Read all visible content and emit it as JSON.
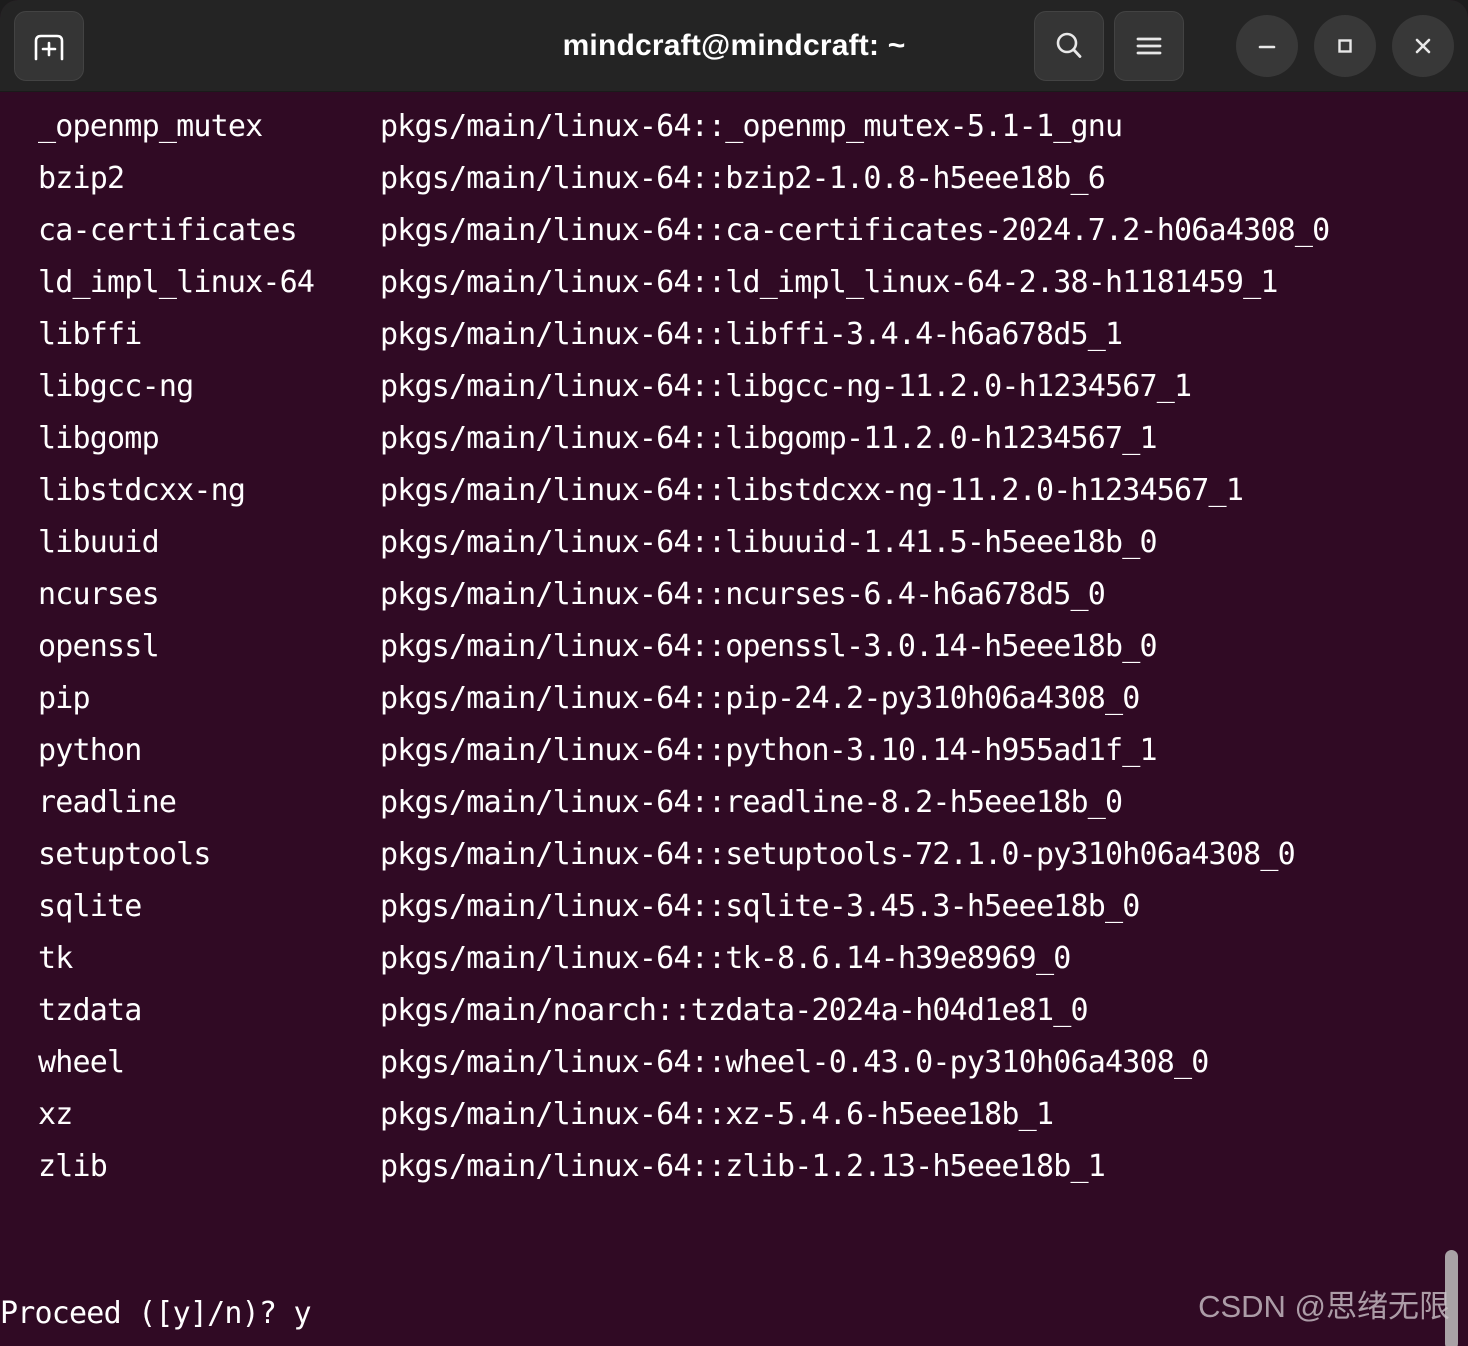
{
  "window": {
    "title": "mindcraft@mindcraft: ~",
    "background_color": "#300a24",
    "titlebar_color": "#242424",
    "text_color": "#ffffff"
  },
  "titlebar": {
    "new_tab_label": "",
    "search_label": "",
    "menu_label": "",
    "minimize_label": "",
    "maximize_label": "",
    "close_label": "",
    "icons": {
      "new_tab": "new-tab-icon",
      "search": "search-icon",
      "menu": "hamburger-menu-icon",
      "minimize": "minimize-icon",
      "maximize": "maximize-icon",
      "close": "close-icon"
    }
  },
  "terminal": {
    "packages": [
      {
        "name": "_openmp_mutex",
        "spec": "pkgs/main/linux-64::_openmp_mutex-5.1-1_gnu"
      },
      {
        "name": "bzip2",
        "spec": "pkgs/main/linux-64::bzip2-1.0.8-h5eee18b_6"
      },
      {
        "name": "ca-certificates",
        "spec": "pkgs/main/linux-64::ca-certificates-2024.7.2-h06a4308_0"
      },
      {
        "name": "ld_impl_linux-64",
        "spec": "pkgs/main/linux-64::ld_impl_linux-64-2.38-h1181459_1"
      },
      {
        "name": "libffi",
        "spec": "pkgs/main/linux-64::libffi-3.4.4-h6a678d5_1"
      },
      {
        "name": "libgcc-ng",
        "spec": "pkgs/main/linux-64::libgcc-ng-11.2.0-h1234567_1"
      },
      {
        "name": "libgomp",
        "spec": "pkgs/main/linux-64::libgomp-11.2.0-h1234567_1"
      },
      {
        "name": "libstdcxx-ng",
        "spec": "pkgs/main/linux-64::libstdcxx-ng-11.2.0-h1234567_1"
      },
      {
        "name": "libuuid",
        "spec": "pkgs/main/linux-64::libuuid-1.41.5-h5eee18b_0"
      },
      {
        "name": "ncurses",
        "spec": "pkgs/main/linux-64::ncurses-6.4-h6a678d5_0"
      },
      {
        "name": "openssl",
        "spec": "pkgs/main/linux-64::openssl-3.0.14-h5eee18b_0"
      },
      {
        "name": "pip",
        "spec": "pkgs/main/linux-64::pip-24.2-py310h06a4308_0"
      },
      {
        "name": "python",
        "spec": "pkgs/main/linux-64::python-3.10.14-h955ad1f_1"
      },
      {
        "name": "readline",
        "spec": "pkgs/main/linux-64::readline-8.2-h5eee18b_0"
      },
      {
        "name": "setuptools",
        "spec": "pkgs/main/linux-64::setuptools-72.1.0-py310h06a4308_0"
      },
      {
        "name": "sqlite",
        "spec": "pkgs/main/linux-64::sqlite-3.45.3-h5eee18b_0"
      },
      {
        "name": "tk",
        "spec": "pkgs/main/linux-64::tk-8.6.14-h39e8969_0"
      },
      {
        "name": "tzdata",
        "spec": "pkgs/main/noarch::tzdata-2024a-h04d1e81_0"
      },
      {
        "name": "wheel",
        "spec": "pkgs/main/linux-64::wheel-0.43.0-py310h06a4308_0"
      },
      {
        "name": "xz",
        "spec": "pkgs/main/linux-64::xz-5.4.6-h5eee18b_1"
      },
      {
        "name": "zlib",
        "spec": "pkgs/main/linux-64::zlib-1.2.13-h5eee18b_1"
      }
    ],
    "prompt": "Proceed ([y]/n)? y"
  },
  "watermark": {
    "text": "CSDN @思绪无限"
  }
}
